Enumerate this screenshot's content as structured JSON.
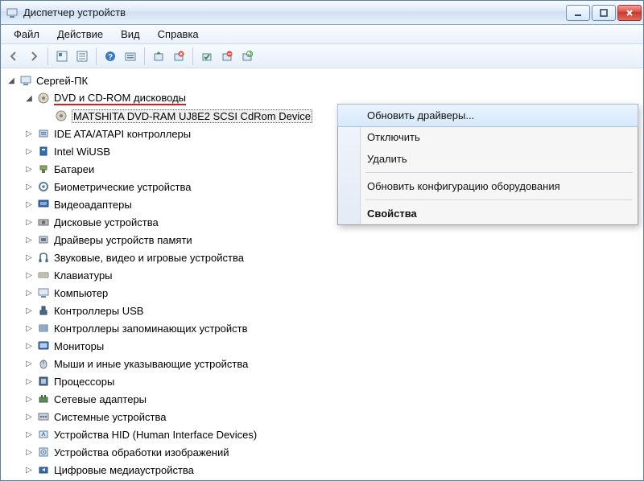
{
  "window": {
    "title": "Диспетчер устройств"
  },
  "menu": {
    "file": "Файл",
    "action": "Действие",
    "view": "Вид",
    "help": "Справка"
  },
  "tree": {
    "root": "Сергей-ПК",
    "items": [
      {
        "label": "DVD и CD-ROM дисководы",
        "expanded": true,
        "underline": true,
        "children": [
          {
            "label": "MATSHITA DVD-RAM UJ8E2 SCSI CdRom Device",
            "selected": true,
            "underline": true
          }
        ]
      },
      {
        "label": "IDE ATA/ATAPI контроллеры"
      },
      {
        "label": "Intel WiUSB"
      },
      {
        "label": "Батареи"
      },
      {
        "label": "Биометрические устройства"
      },
      {
        "label": "Видеоадаптеры"
      },
      {
        "label": "Дисковые устройства"
      },
      {
        "label": "Драйверы устройств памяти"
      },
      {
        "label": "Звуковые, видео и игровые устройства"
      },
      {
        "label": "Клавиатуры"
      },
      {
        "label": "Компьютер"
      },
      {
        "label": "Контроллеры USB"
      },
      {
        "label": "Контроллеры запоминающих устройств"
      },
      {
        "label": "Мониторы"
      },
      {
        "label": "Мыши и иные указывающие устройства"
      },
      {
        "label": "Процессоры"
      },
      {
        "label": "Сетевые адаптеры"
      },
      {
        "label": "Системные устройства"
      },
      {
        "label": "Устройства HID (Human Interface Devices)"
      },
      {
        "label": "Устройства обработки изображений"
      },
      {
        "label": "Цифровые медиаустройства"
      }
    ]
  },
  "context_menu": {
    "update_drivers": "Обновить драйверы...",
    "disable": "Отключить",
    "delete": "Удалить",
    "scan_hw": "Обновить конфигурацию оборудования",
    "properties": "Свойства"
  }
}
